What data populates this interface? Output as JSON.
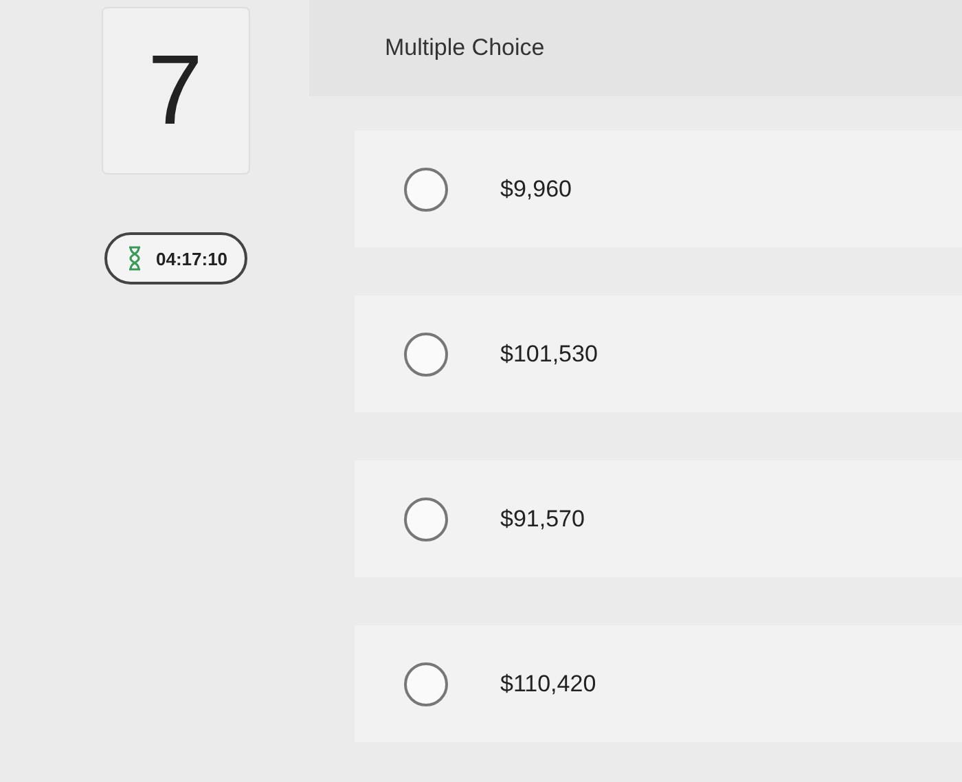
{
  "question": {
    "number": "7"
  },
  "timer": {
    "time": "04:17:10"
  },
  "heading": "Multiple Choice",
  "options": [
    {
      "label": "$9,960",
      "selected": false
    },
    {
      "label": "$101,530",
      "selected": false
    },
    {
      "label": "$91,570",
      "selected": false
    },
    {
      "label": "$110,420",
      "selected": false
    }
  ]
}
